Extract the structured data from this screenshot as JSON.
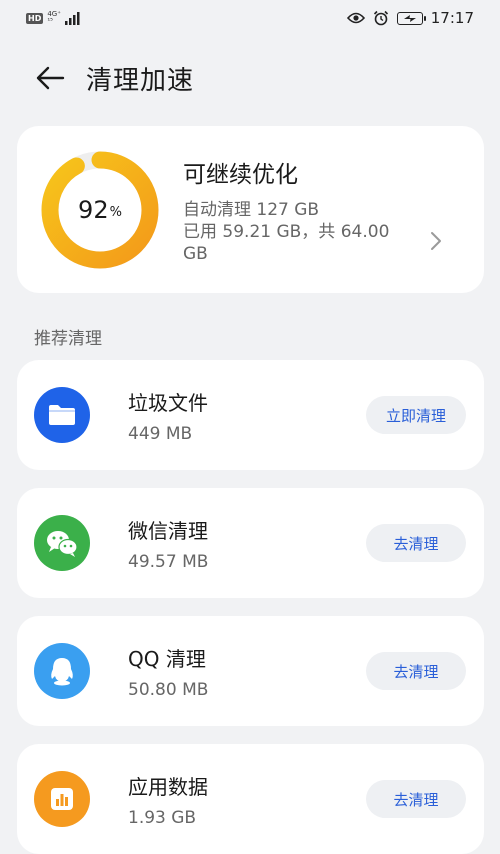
{
  "status_bar": {
    "hd": "HD",
    "network": "4G⁺",
    "signal_extra": "¹⁵",
    "time": "17:17"
  },
  "header": {
    "title": "清理加速"
  },
  "summary": {
    "percent": "92",
    "percent_unit": "%",
    "percent_value": 0.92,
    "title": "可继续优化",
    "auto_clean": "自动清理 127 GB",
    "usage": "已用 59.21 GB，共 64.00 GB"
  },
  "section": {
    "label": "推荐清理"
  },
  "items": [
    {
      "name": "垃圾文件",
      "size": "449 MB",
      "button": "立即清理",
      "icon": "folder-icon",
      "color": "#1f63e8"
    },
    {
      "name": "微信清理",
      "size": "49.57 MB",
      "button": "去清理",
      "icon": "wechat-icon",
      "color": "#3bb04a"
    },
    {
      "name": "QQ 清理",
      "size": "50.80 MB",
      "button": "去清理",
      "icon": "qq-penguin-icon",
      "color": "#3a9ff0"
    },
    {
      "name": "应用数据",
      "size": "1.93 GB",
      "button": "去清理",
      "icon": "bar-chart-icon",
      "color": "#f59a1f"
    }
  ],
  "colors": {
    "ring_start": "#f39a1a",
    "ring_end": "#f7c51b",
    "button_text": "#2a5fd8"
  }
}
